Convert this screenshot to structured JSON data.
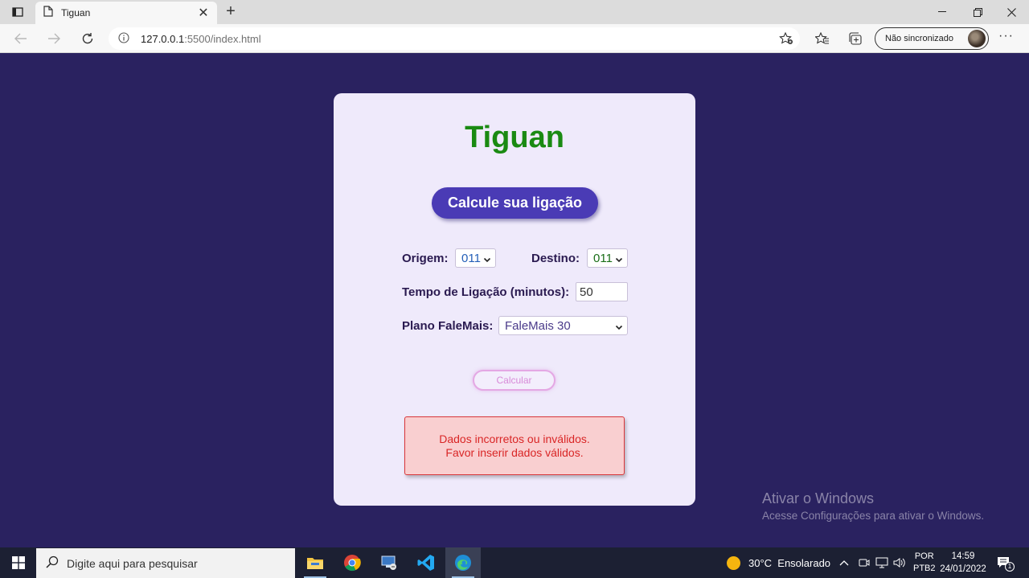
{
  "browser": {
    "tab_title": "Tiguan",
    "url_host": "127.0.0.1",
    "url_path": ":5500/index.html",
    "profile_label": "Não sincronizado",
    "more_label": "···",
    "tab_close": "✕",
    "newtab_label": "+"
  },
  "page": {
    "title": "Tiguan",
    "header_button": "Calcule sua ligação",
    "origem_label": "Origem:",
    "origem_value": "011",
    "destino_label": "Destino:",
    "destino_value": "011",
    "tempo_label": "Tempo de Ligação (minutos):",
    "tempo_value": "50",
    "plano_label": "Plano FaleMais:",
    "plano_value": "FaleMais 30",
    "calc_button": "Calcular",
    "error_line1": "Dados incorretos ou inválidos.",
    "error_line2": "Favor inserir dados válidos."
  },
  "watermark": {
    "title": "Ativar o Windows",
    "subtitle": "Acesse Configurações para ativar o Windows."
  },
  "taskbar": {
    "search_placeholder": "Digite aqui para pesquisar",
    "weather": "30°C  Ensolarado",
    "lang_top": "POR",
    "lang_bottom": "PTB2",
    "time": "14:59",
    "date": "24/01/2022",
    "notification_count": "1"
  },
  "colors": {
    "page_bg": "#2a2260",
    "card_bg": "#efeafb",
    "title_green": "#1a8a12",
    "pill_purple": "#4a3bb5",
    "error_red": "#d92626"
  }
}
